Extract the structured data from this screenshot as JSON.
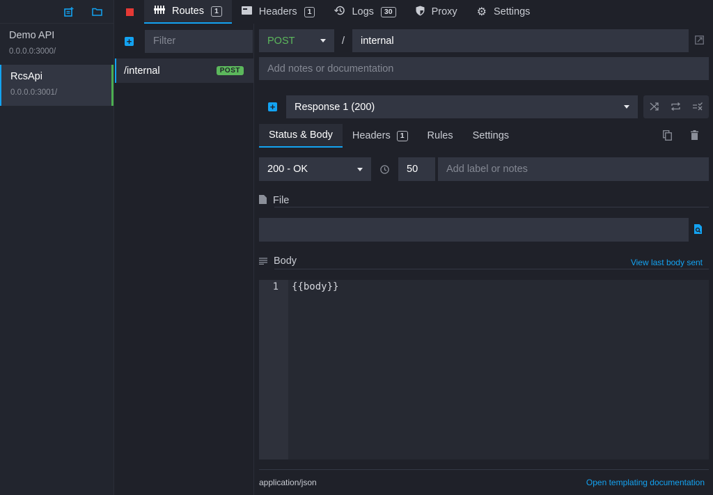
{
  "env_sidebar": {
    "icons": {
      "add_env": "new-environment-icon",
      "open_env": "folder-icon"
    },
    "environments": [
      {
        "name": "Demo API",
        "address": "0.0.0.0:3000/",
        "active": false
      },
      {
        "name": "RcsApi",
        "address": "0.0.0.0:3001/",
        "active": true
      }
    ]
  },
  "topbar": {
    "stop_icon": "stop-icon",
    "tabs": [
      {
        "label": "Routes",
        "count": "1",
        "icon": "routes-icon",
        "active": true
      },
      {
        "label": "Headers",
        "count": "1",
        "icon": "headers-icon",
        "active": false
      },
      {
        "label": "Logs",
        "count": "30",
        "icon": "history-icon",
        "active": false
      },
      {
        "label": "Proxy",
        "icon": "shield-icon",
        "active": false
      },
      {
        "label": "Settings",
        "icon": "gear-icon",
        "active": false
      }
    ]
  },
  "routes": {
    "filter_placeholder": "Filter",
    "items": [
      {
        "path": "/internal",
        "method": "POST"
      }
    ]
  },
  "route_editor": {
    "method": "POST",
    "separator": "/",
    "path": "internal",
    "notes_placeholder": "Add notes or documentation",
    "response_select": "Response 1 (200)",
    "subtabs": [
      {
        "label": "Status & Body",
        "active": true
      },
      {
        "label": "Headers",
        "count": "1",
        "active": false
      },
      {
        "label": "Rules",
        "active": false
      },
      {
        "label": "Settings",
        "active": false
      }
    ],
    "status": "200 - OK",
    "latency": "50",
    "label_placeholder": "Add label or notes",
    "file_title": "File",
    "file_value": "",
    "body_title": "Body",
    "view_last_body": "View last body sent",
    "body_lines": [
      {
        "number": "1",
        "text": "{{body}}"
      }
    ],
    "content_type": "application/json",
    "templating_link": "Open templating documentation"
  },
  "colors": {
    "accent": "#13a3f2",
    "post": "#5cb85c",
    "stop": "#e53935",
    "background": "#1f2129",
    "field": "#323642"
  }
}
